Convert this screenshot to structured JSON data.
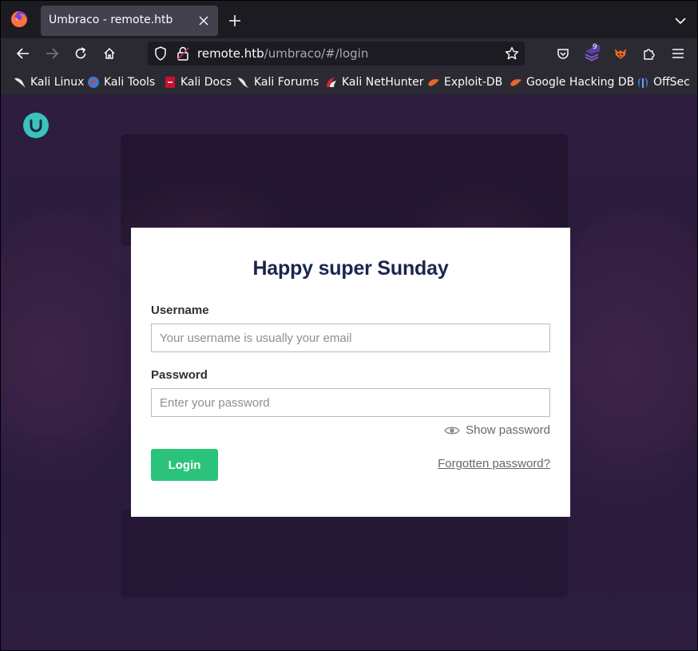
{
  "browser": {
    "tab_title": "Umbraco - remote.htb",
    "url_host": "remote.htb",
    "url_path": "/umbraco/#/login",
    "extension_badge": "9"
  },
  "bookmarks": [
    {
      "label": "Kali Linux",
      "icon": "kali-dragon-icon"
    },
    {
      "label": "Kali Tools",
      "icon": "kali-tools-icon"
    },
    {
      "label": "Kali Docs",
      "icon": "kali-docs-icon"
    },
    {
      "label": "Kali Forums",
      "icon": "kali-forums-icon"
    },
    {
      "label": "Kali NetHunter",
      "icon": "nethunter-icon"
    },
    {
      "label": "Exploit-DB",
      "icon": "exploit-db-icon"
    },
    {
      "label": "Google Hacking DB",
      "icon": "ghdb-icon"
    },
    {
      "label": "OffSec",
      "icon": "offsec-icon"
    }
  ],
  "login": {
    "greeting": "Happy super Sunday",
    "username_label": "Username",
    "username_placeholder": "Your username is usually your email",
    "password_label": "Password",
    "password_placeholder": "Enter your password",
    "show_password": "Show password",
    "login_button": "Login",
    "forgot_link": "Forgotten password?"
  },
  "colors": {
    "accent_green": "#2bc37c",
    "logo_teal": "#3bc2bd",
    "background_purple": "#2b1c3d"
  }
}
